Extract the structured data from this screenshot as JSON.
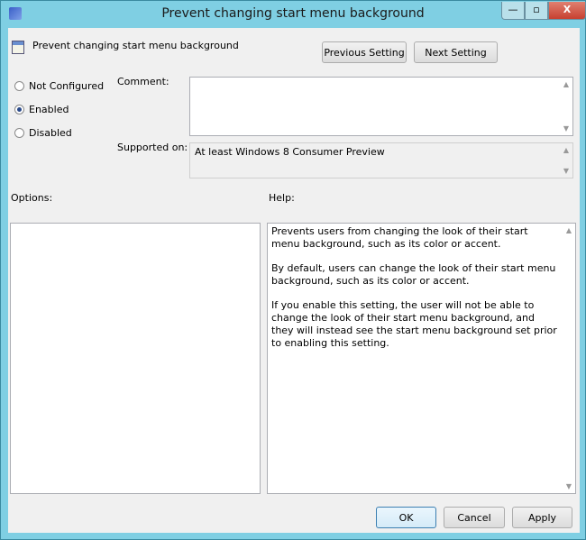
{
  "window": {
    "title": "Prevent changing start menu background",
    "minimize": "—",
    "maximize": "▫",
    "close": "X"
  },
  "header": {
    "setting_name": "Prevent changing start menu background",
    "previous_label": "Previous Setting",
    "next_label": "Next Setting"
  },
  "state": {
    "options": [
      "Not Configured",
      "Enabled",
      "Disabled"
    ],
    "selected": "Enabled"
  },
  "comment": {
    "label": "Comment:",
    "value": ""
  },
  "supported": {
    "label": "Supported on:",
    "value": "At least Windows 8 Consumer Preview"
  },
  "options_label": "Options:",
  "help": {
    "label": "Help:",
    "paragraphs": [
      "Prevents users from changing the look of their start menu background, such as its color or accent.",
      "By default, users can change the look of their start menu background, such as its color or accent.",
      "If you enable this setting, the user will not be able to change the look of their start menu background, and they will instead see the start menu background set prior to enabling this setting."
    ]
  },
  "footer": {
    "ok": "OK",
    "cancel": "Cancel",
    "apply": "Apply"
  },
  "colors": {
    "frame": "#7fcfe3",
    "client": "#f0f0f0"
  }
}
